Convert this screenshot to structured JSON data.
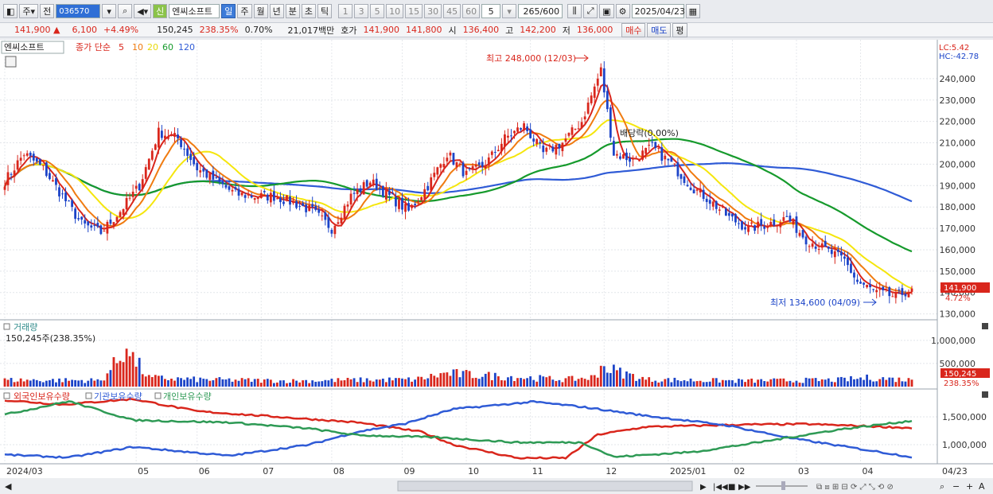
{
  "toolbar": {
    "period_sel": "주",
    "market_sel": "전",
    "code": "036570",
    "sin": "신",
    "stock_name": "엔씨소프트",
    "tabs": [
      "일",
      "주",
      "월",
      "년",
      "분",
      "초",
      "틱"
    ],
    "active_tab": "일",
    "nums": [
      "1",
      "3",
      "5",
      "10",
      "15",
      "30",
      "45",
      "60"
    ],
    "count_sel": "5",
    "range": "265",
    "range_max": "/600",
    "date": "2025/04/23"
  },
  "quote": {
    "price": "141,900",
    "arrow": "▲",
    "change": "6,100",
    "change_pct": "+4.49%",
    "volume": "150,245",
    "vol_ratio": "238.35%",
    "turnover": "0.70%",
    "amount": "21,017백만",
    "ask_label": "호가",
    "ask": "141,900",
    "bid": "141,800",
    "open_label": "시",
    "open": "136,400",
    "high_label": "고",
    "high": "142,200",
    "low_label": "저",
    "low": "136,000",
    "buy": "매수",
    "sell": "매도",
    "avg": "평"
  },
  "legend": {
    "name": "엔씨소프트",
    "title": "종가 단순",
    "ma": [
      "5",
      "10",
      "20",
      "60",
      "120"
    ],
    "ma_colors": [
      "#d9261c",
      "#f07b10",
      "#e8d90a",
      "#169a2c",
      "#2f5bd6"
    ]
  },
  "annotations": {
    "high": "최고 248,000 (12/03)",
    "low": "최저 134,600 (04/09)",
    "dividend": "배당락(0.00%)",
    "lc": "LC:5.42",
    "hc": "HC:-42.78",
    "last_price": "141,900",
    "last_pct": "4.72%",
    "vol_last": "150,245",
    "vol_last_pct": "238.35%"
  },
  "volume_panel": {
    "title": "거래량",
    "value": "150,245주(238.35%)"
  },
  "holding_panel": {
    "legend": [
      "외국인보유수량",
      "기관보유수량",
      "개인보유수량"
    ],
    "colors": [
      "#d9261c",
      "#2f5bd6",
      "#2e9a55"
    ]
  },
  "chart_data": {
    "type": "candlestick",
    "price_ticks": [
      "240,000",
      "230,000",
      "220,000",
      "210,000",
      "200,000",
      "190,000",
      "180,000",
      "170,000",
      "160,000",
      "150,000",
      "140,000",
      "130,000"
    ],
    "price_ylim": [
      128000,
      250000
    ],
    "volume_ticks": [
      "500,000",
      "1,000,000"
    ],
    "volume_ylim": [
      0,
      1100000
    ],
    "holding_ticks": [
      "1,500,000",
      "1,000,000"
    ],
    "holding_ylim": [
      700000,
      1900000
    ],
    "x_labels": [
      "2024/03",
      "05",
      "06",
      "07",
      "08",
      "09",
      "10",
      "11",
      "12",
      "2025/01",
      "02",
      "03",
      "04",
      "04/23"
    ],
    "close_anchors": [
      [
        0,
        192000
      ],
      [
        6,
        205000
      ],
      [
        12,
        198000
      ],
      [
        18,
        185000
      ],
      [
        24,
        172000
      ],
      [
        30,
        168000
      ],
      [
        36,
        178000
      ],
      [
        42,
        190000
      ],
      [
        48,
        215000
      ],
      [
        54,
        212000
      ],
      [
        60,
        198000
      ],
      [
        66,
        192000
      ],
      [
        72,
        186000
      ],
      [
        78,
        185000
      ],
      [
        84,
        185000
      ],
      [
        90,
        182000
      ],
      [
        96,
        178000
      ],
      [
        102,
        170000
      ],
      [
        108,
        185000
      ],
      [
        114,
        192000
      ],
      [
        120,
        185000
      ],
      [
        126,
        178000
      ],
      [
        132,
        190000
      ],
      [
        138,
        205000
      ],
      [
        144,
        195000
      ],
      [
        150,
        200000
      ],
      [
        156,
        212000
      ],
      [
        162,
        218000
      ],
      [
        168,
        205000
      ],
      [
        174,
        210000
      ],
      [
        180,
        220000
      ],
      [
        186,
        244000
      ],
      [
        190,
        205000
      ],
      [
        196,
        202000
      ],
      [
        202,
        208000
      ],
      [
        208,
        200000
      ],
      [
        214,
        190000
      ],
      [
        220,
        183000
      ],
      [
        226,
        175000
      ],
      [
        232,
        170000
      ],
      [
        238,
        172000
      ],
      [
        244,
        175000
      ],
      [
        250,
        165000
      ],
      [
        256,
        160000
      ],
      [
        262,
        155000
      ],
      [
        266,
        145000
      ],
      [
        272,
        140000
      ],
      [
        278,
        138000
      ],
      [
        283,
        141900
      ]
    ],
    "volume_anchors": [
      [
        0,
        150000
      ],
      [
        30,
        140000
      ],
      [
        38,
        820000
      ],
      [
        45,
        200000
      ],
      [
        60,
        160000
      ],
      [
        90,
        130000
      ],
      [
        110,
        150000
      ],
      [
        128,
        160000
      ],
      [
        138,
        300000
      ],
      [
        150,
        250000
      ],
      [
        175,
        160000
      ],
      [
        185,
        220000
      ],
      [
        186,
        450000
      ],
      [
        200,
        160000
      ],
      [
        230,
        130000
      ],
      [
        260,
        150000
      ],
      [
        270,
        200000
      ],
      [
        283,
        150245
      ]
    ],
    "foreign_anchors": [
      [
        0,
        1800000
      ],
      [
        18,
        1720000
      ],
      [
        40,
        1820000
      ],
      [
        60,
        1600000
      ],
      [
        90,
        1480000
      ],
      [
        110,
        1400000
      ],
      [
        130,
        1230000
      ],
      [
        140,
        1000000
      ],
      [
        160,
        760000
      ],
      [
        175,
        760000
      ],
      [
        185,
        1180000
      ],
      [
        200,
        1320000
      ],
      [
        230,
        1360000
      ],
      [
        250,
        1370000
      ],
      [
        270,
        1330000
      ],
      [
        283,
        1300000
      ]
    ],
    "inst_anchors": [
      [
        0,
        820000
      ],
      [
        20,
        770000
      ],
      [
        40,
        960000
      ],
      [
        70,
        800000
      ],
      [
        95,
        1000000
      ],
      [
        110,
        1230000
      ],
      [
        125,
        1380000
      ],
      [
        140,
        1640000
      ],
      [
        165,
        1770000
      ],
      [
        180,
        1680000
      ],
      [
        200,
        1520000
      ],
      [
        225,
        1350000
      ],
      [
        245,
        1120000
      ],
      [
        265,
        940000
      ],
      [
        283,
        780000
      ]
    ],
    "indiv_anchors": [
      [
        0,
        1540000
      ],
      [
        20,
        1780000
      ],
      [
        40,
        1440000
      ],
      [
        70,
        1400000
      ],
      [
        95,
        1290000
      ],
      [
        110,
        1170000
      ],
      [
        135,
        1130000
      ],
      [
        160,
        1040000
      ],
      [
        180,
        1040000
      ],
      [
        190,
        780000
      ],
      [
        215,
        870000
      ],
      [
        235,
        1040000
      ],
      [
        260,
        1270000
      ],
      [
        283,
        1430000
      ]
    ]
  }
}
